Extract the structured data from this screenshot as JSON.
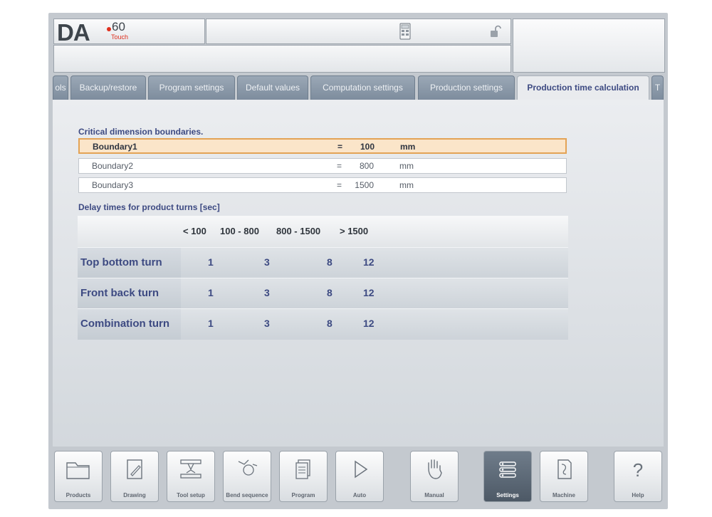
{
  "header": {
    "logo_text": "DA",
    "logo_number": "60",
    "logo_sub": "Touch"
  },
  "tabs": [
    {
      "label": "ols"
    },
    {
      "label": "Backup/restore"
    },
    {
      "label": "Program settings"
    },
    {
      "label": "Default values"
    },
    {
      "label": "Computation settings"
    },
    {
      "label": "Production settings"
    },
    {
      "label": "Production time calculation"
    },
    {
      "label": "T"
    }
  ],
  "boundaries": {
    "title": "Critical dimension boundaries.",
    "rows": [
      {
        "name": "Boundary1",
        "eq": "=",
        "value": "100",
        "unit": "mm"
      },
      {
        "name": "Boundary2",
        "eq": "=",
        "value": "800",
        "unit": "mm"
      },
      {
        "name": "Boundary3",
        "eq": "=",
        "value": "1500",
        "unit": "mm"
      }
    ]
  },
  "delay": {
    "title": "Delay times for product turns [sec]",
    "columns": [
      "< 100",
      "100 - 800",
      "800 - 1500",
      "> 1500"
    ],
    "rows": [
      {
        "label": "Top bottom turn",
        "values": [
          "1",
          "3",
          "8",
          "12"
        ]
      },
      {
        "label": "Front back turn",
        "values": [
          "1",
          "3",
          "8",
          "12"
        ]
      },
      {
        "label": "Combination turn",
        "values": [
          "1",
          "3",
          "8",
          "12"
        ]
      }
    ]
  },
  "toolbar": [
    {
      "label": "Products",
      "icon": "folder-icon"
    },
    {
      "label": "Drawing",
      "icon": "drawing-icon"
    },
    {
      "label": "Tool setup",
      "icon": "tool-setup-icon"
    },
    {
      "label": "Bend sequence",
      "icon": "bend-sequence-icon"
    },
    {
      "label": "Program",
      "icon": "program-icon"
    },
    {
      "label": "Auto",
      "icon": "play-icon"
    },
    {
      "label": "Manual",
      "icon": "hand-icon"
    },
    {
      "label": "Settings",
      "icon": "settings-icon",
      "active": true
    },
    {
      "label": "Machine",
      "icon": "machine-icon"
    },
    {
      "label": "Help",
      "icon": "help-icon"
    }
  ],
  "colors": {
    "accent": "#3d4a82",
    "selection_fill": "#fbe5c9",
    "selection_border": "#e3a356",
    "logo_red": "#e0301e"
  }
}
